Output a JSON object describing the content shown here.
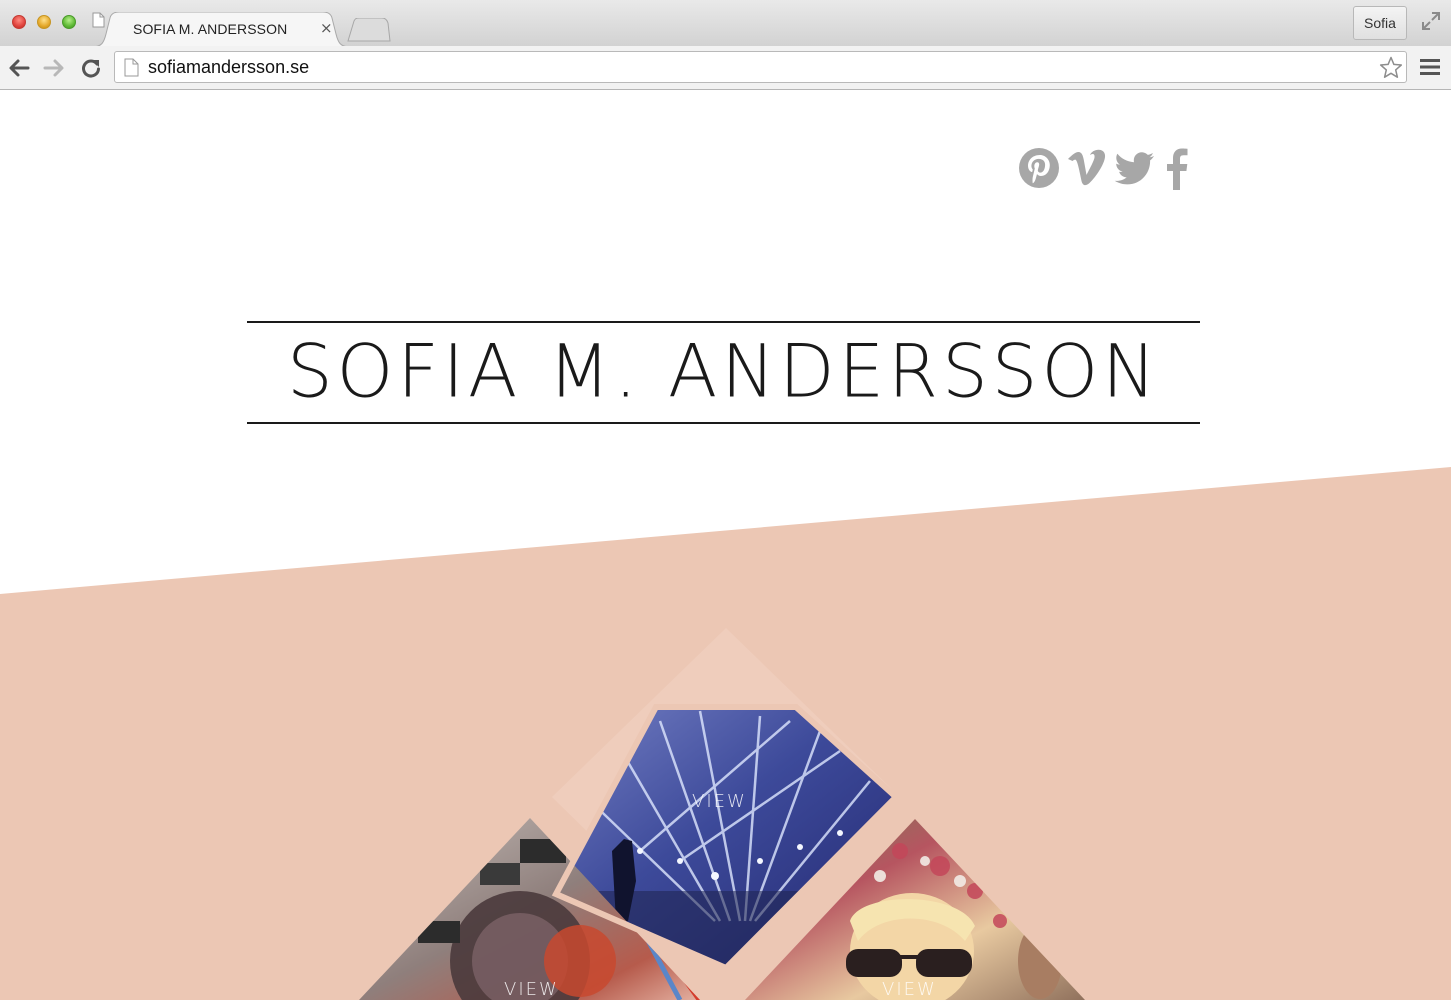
{
  "browser": {
    "tab_title": "SOFIA M. ANDERSSON",
    "tab_close": "×",
    "profile_name": "Sofia",
    "url": "sofiamandersson.se"
  },
  "header": {
    "social_icons": [
      "pinterest-icon",
      "vimeo-icon",
      "twitter-icon",
      "facebook-icon"
    ],
    "social_color": "#a7a7a7"
  },
  "logo": {
    "title": "SOFIA M. ANDERSSON"
  },
  "portfolio": {
    "background_color": "#ecc7b4",
    "items": [
      {
        "label": "VIEW",
        "theme": "concert"
      },
      {
        "label": "VIEW",
        "theme": "records"
      },
      {
        "label": "VIEW",
        "theme": "festival"
      }
    ]
  }
}
